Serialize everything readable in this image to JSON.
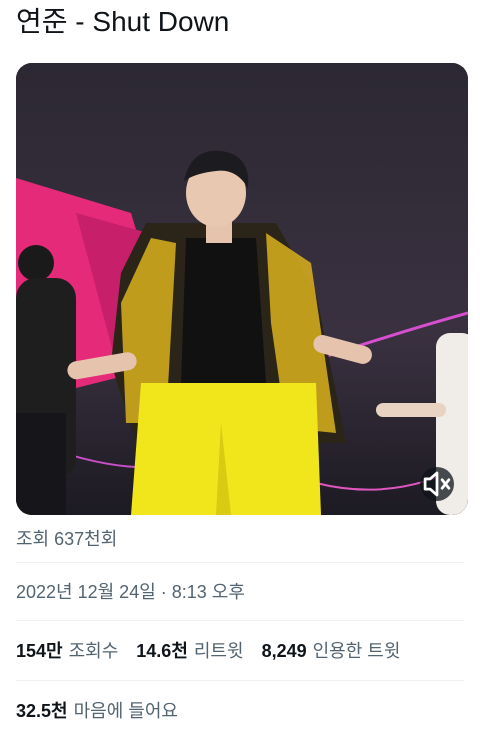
{
  "tweet": {
    "title": "연준 - Shut Down",
    "views_line": "조회 637천회",
    "timestamp": "2022년 12월 24일 · 8:13 오후"
  },
  "media": {
    "type": "video",
    "muted": true,
    "mute_icon": "speaker-muted-icon"
  },
  "stats": [
    {
      "value": "154만",
      "label": "조회수"
    },
    {
      "value": "14.6천",
      "label": "리트윗"
    },
    {
      "value": "8,249",
      "label": "인용한 트윗"
    }
  ],
  "likes": {
    "value": "32.5천",
    "label": "마음에 들어요"
  },
  "colors": {
    "text_primary": "#0f1419",
    "text_secondary": "#536471",
    "divider": "#eff3f4"
  }
}
